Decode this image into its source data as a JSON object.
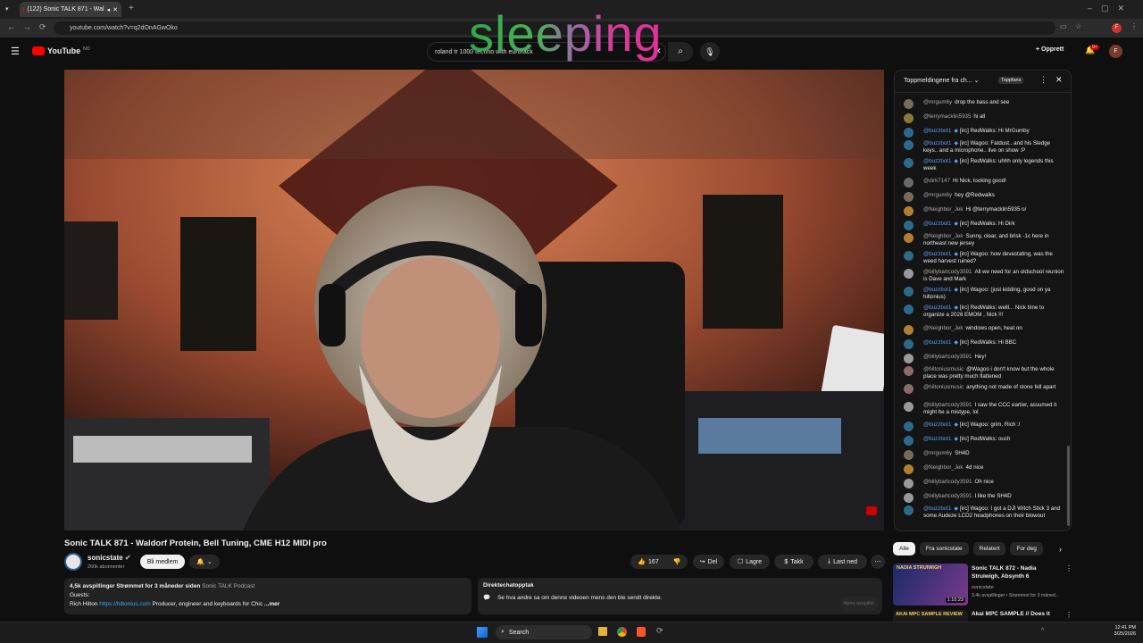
{
  "browser": {
    "tab_title": "(122) Sonic TALK 871 - Wal",
    "url": "youtube.com/watch?v=q2dOnAGwOko"
  },
  "overlay_text": "sleeping",
  "yt": {
    "logo": "YouTube",
    "logo_sup": "NO",
    "search_value": "roland tr 1000 techno with eurorack",
    "create_label": "Opprett",
    "notif_count": "9+",
    "avatar_letter": "F"
  },
  "video": {
    "title": "Sonic TALK 871 - Waldorf Protein, Bell Tuning, CME H12 MIDI pro"
  },
  "channel": {
    "name": "sonicstate",
    "subs": "260k abonnenter",
    "join_label": "Bli medlem"
  },
  "actions": {
    "likes": "167",
    "share": "Del",
    "save": "Lagre",
    "thanks": "Takk",
    "download": "Last ned"
  },
  "description": {
    "stats": "4,5k avspillinger  Strømmet for 3 måneder siden",
    "podcast": "Sonic TALK Podcast",
    "guests": "Guests:",
    "guest_name": "Rich Hilton",
    "guest_link": "https://hiltonius.com",
    "guest_desc": "Producer, engineer and keyboards for Chic",
    "more": "...mer"
  },
  "replay": {
    "title": "Direktechatopptak",
    "text": "Se hva andre sa om denne videoen mens den ble sendt direkte.",
    "button": "Apne avspiller"
  },
  "chat": {
    "header": "Toppmeldingene fra ch...",
    "badge": "Toppfans",
    "messages": [
      {
        "author": "@mrgum6y",
        "text": "drop the bass and see",
        "mod": false,
        "color": "#7a6a5a"
      },
      {
        "author": "@terrymacklin5935",
        "text": "hi all",
        "mod": false,
        "color": "#8a7a3a"
      },
      {
        "author": "@buzzbot1",
        "text": "[irc] RedWalks: Hi MrGumby",
        "mod": true,
        "color": "#2d6a8a"
      },
      {
        "author": "@buzzbot1",
        "text": "[irc] Wagoo: Fatdust.. and his Sledge keys.. and a microphone.. live on show :P",
        "mod": true,
        "color": "#2d6a8a"
      },
      {
        "author": "@buzzbot1",
        "text": "[irc] RedWalks: uhhh only legends this week",
        "mod": true,
        "color": "#2d6a8a"
      },
      {
        "author": "@dirk7147",
        "text": "Hi Nick, looking good!",
        "mod": false,
        "color": "#6a6a6a"
      },
      {
        "author": "@mrgum6y",
        "text": "hey @Redwalks",
        "mod": false,
        "color": "#7a6a5a"
      },
      {
        "author": "@Neighbor_Jek",
        "text": "Hi @terrymacklin5935 o/",
        "mod": false,
        "color": "#b08030"
      },
      {
        "author": "@buzzbot1",
        "text": "[irc] RedWalks: Hi Dirk",
        "mod": true,
        "color": "#2d6a8a"
      },
      {
        "author": "@Neighbor_Jek",
        "text": "Sunny, clear, and brisk -1c here in northeast new jersey",
        "mod": false,
        "color": "#b08030"
      },
      {
        "author": "@buzzbot1",
        "text": "[irc] Wagoo: how devastating, was the weed harvest ruined?",
        "mod": true,
        "color": "#2d6a8a"
      },
      {
        "author": "@billybartcody3591",
        "text": "All we need for an oldschool reunion is Dave and Mark",
        "mod": false,
        "color": "#9a9a9a"
      },
      {
        "author": "@buzzbot1",
        "text": "[irc] Wagoo: (just kidding, good on ya hiltonius)",
        "mod": true,
        "color": "#2d6a8a"
      },
      {
        "author": "@buzzbot1",
        "text": "[irc] RedWalks: welll... Nick time to organize a 2026 EMOM , Nick !!!",
        "mod": true,
        "color": "#2d6a8a"
      },
      {
        "author": "@Neighbor_Jek",
        "text": "windows open, heat on",
        "mod": false,
        "color": "#b08030"
      },
      {
        "author": "@buzzbot1",
        "text": "[irc] RedWalks: Hi BBC",
        "mod": true,
        "color": "#2d6a8a"
      },
      {
        "author": "@billybartcody3591",
        "text": "Hey!",
        "mod": false,
        "color": "#9a9a9a"
      },
      {
        "author": "@hiltoniusmusic",
        "text": "@Wagoo i don't know but the whole place was pretty much flattened",
        "mod": false,
        "color": "#8a6a6a"
      },
      {
        "author": "@hiltoniusmusic",
        "text": "anything not made of stone fell apart",
        "mod": false,
        "color": "#8a6a6a"
      },
      {
        "author": "@billybartcody3591",
        "text": "I saw the CCC earlier, assumed it might be a mistype, lol",
        "mod": false,
        "color": "#9a9a9a"
      },
      {
        "author": "@buzzbot1",
        "text": "[irc] Wagoo: grim, Rich :/",
        "mod": true,
        "color": "#2d6a8a"
      },
      {
        "author": "@buzzbot1",
        "text": "[irc] RedWalks: ouch",
        "mod": true,
        "color": "#2d6a8a"
      },
      {
        "author": "@mrgum6y",
        "text": "SH4D",
        "mod": false,
        "color": "#7a6a5a"
      },
      {
        "author": "@Neighbor_Jek",
        "text": "4d nice",
        "mod": false,
        "color": "#b08030"
      },
      {
        "author": "@billybartcody3591",
        "text": "Oh nice",
        "mod": false,
        "color": "#9a9a9a"
      },
      {
        "author": "@billybartcody3591",
        "text": "I like the SH4D",
        "mod": false,
        "color": "#9a9a9a"
      },
      {
        "author": "@buzzbot1",
        "text": "[irc] Wagoo: I got a DJI Witch Stick 3 and some Audeze LCD2 headphones on their blowout",
        "mod": true,
        "color": "#2d6a8a"
      }
    ]
  },
  "chips": [
    "Alle",
    "Fra sonicstate",
    "Relatert",
    "For deg"
  ],
  "recs": [
    {
      "title": "Sonic TALK 872 - Nadia Struiwigh, Absynth 6",
      "channel": "sonicstate",
      "meta": "3,4k avspillinger • Strømmet for 3 måned...",
      "duration": "1:10:23",
      "thumb_text": "NADIA STRUIWIGH"
    },
    {
      "title": "Akai MPC SAMPLE // Does it",
      "thumb_text": "AKAI MPC SAMPLE  REVIEW"
    }
  ],
  "taskbar": {
    "search": "Search",
    "time": "12:41 PM",
    "date": "3/25/2026"
  }
}
